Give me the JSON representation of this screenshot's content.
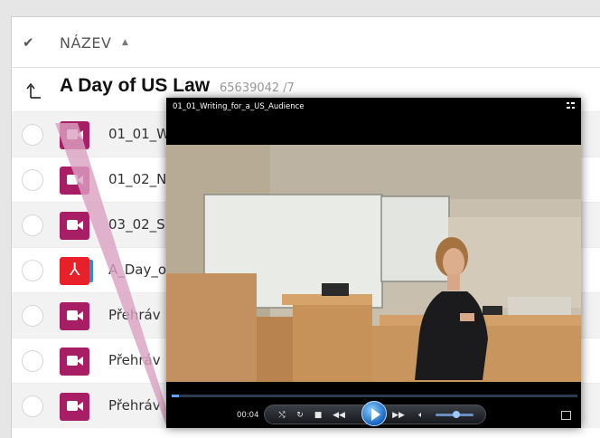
{
  "header": {
    "name_label": "NÁZEV"
  },
  "folder": {
    "title": "A Day of US Law",
    "meta": "65639042 /7"
  },
  "files": [
    {
      "type": "video",
      "name": "01_01_Writing_for_a_US_Audience"
    },
    {
      "type": "video",
      "name": "01_02_N"
    },
    {
      "type": "video",
      "name": "03_02_S"
    },
    {
      "type": "pdf",
      "name": "A_Day_o"
    },
    {
      "type": "video",
      "name": "Přehráv"
    },
    {
      "type": "video",
      "name": "Přehráv"
    },
    {
      "type": "video",
      "name": "Přehráv"
    }
  ],
  "player": {
    "title": "01_01_Writing_for_a_US_Audience",
    "time": "00:04",
    "progress": 0.017,
    "volume": 0.55
  },
  "colors": {
    "video_icon": "#a81e64",
    "pdf_icon": "#e8202a",
    "connector": "#d9a0c0",
    "play_button": "#1565c0"
  }
}
